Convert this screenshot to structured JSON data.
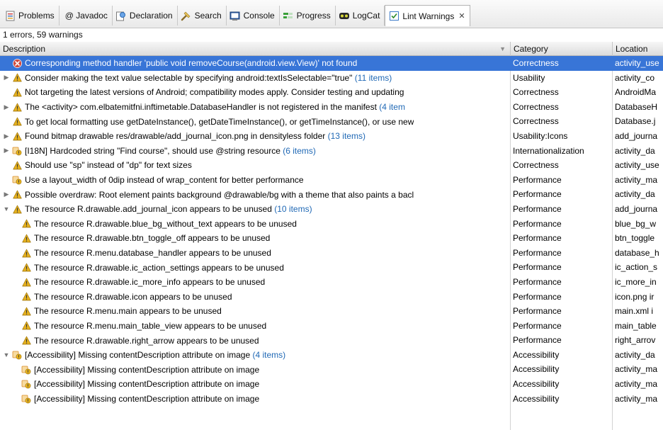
{
  "tabs": [
    {
      "label": "Problems",
      "icon": "problems-icon",
      "active": false
    },
    {
      "label": "@ Javadoc",
      "icon": "none",
      "active": false
    },
    {
      "label": "Declaration",
      "icon": "declaration-icon",
      "active": false
    },
    {
      "label": "Search",
      "icon": "search-icon",
      "active": false
    },
    {
      "label": "Console",
      "icon": "console-icon",
      "active": false
    },
    {
      "label": "Progress",
      "icon": "progress-icon",
      "active": false
    },
    {
      "label": "LogCat",
      "icon": "logcat-icon",
      "active": false
    },
    {
      "label": "Lint Warnings",
      "icon": "lint-checkbox-icon",
      "active": true
    }
  ],
  "close_glyph": "✕",
  "summary": "1 errors, 59 warnings",
  "columns": {
    "description": "Description",
    "category": "Category",
    "location": "Location"
  },
  "colors": {
    "selected": "#3875d7",
    "count_link": "#1f68b5",
    "error": "#d24b3c",
    "warning": "#e7b21e",
    "i18n": "#d98c2a"
  },
  "rows": [
    {
      "indent": 0,
      "twisty": "",
      "severity": "error",
      "description": "Corresponding method handler 'public void removeCourse(android.view.View)' not found",
      "count": "",
      "category": "Correctness",
      "location": "activity_use",
      "selected": true
    },
    {
      "indent": 0,
      "twisty": "collapsed",
      "severity": "warning",
      "description": "Consider making the text value selectable by specifying android:textIsSelectable=\"true\"",
      "count": "(11 items)",
      "category": "Usability",
      "location": "activity_co",
      "selected": false
    },
    {
      "indent": 0,
      "twisty": "",
      "severity": "warning",
      "description": "Not targeting the latest versions of Android; compatibility modes apply. Consider testing and updating",
      "count": "",
      "category": "Correctness",
      "location": "AndroidMa",
      "selected": false
    },
    {
      "indent": 0,
      "twisty": "collapsed",
      "severity": "warning",
      "description": "The <activity> com.elbatemitfni.inftimetable.DatabaseHandler is not registered in the manifest",
      "count": "(4 item",
      "category": "Correctness",
      "location": "DatabaseH",
      "selected": false
    },
    {
      "indent": 0,
      "twisty": "",
      "severity": "warning",
      "description": "To get local formatting use getDateInstance(), getDateTimeInstance(), or getTimeInstance(), or use new",
      "count": "",
      "category": "Correctness",
      "location": "Database.j",
      "selected": false
    },
    {
      "indent": 0,
      "twisty": "collapsed",
      "severity": "warning",
      "description": "Found bitmap drawable res/drawable/add_journal_icon.png in densityless folder",
      "count": "(13 items)",
      "category": "Usability:Icons",
      "location": "add_journa",
      "selected": false
    },
    {
      "indent": 0,
      "twisty": "collapsed",
      "severity": "i18n",
      "description": "[I18N] Hardcoded string \"Find course\", should use @string resource",
      "count": "(6 items)",
      "category": "Internationalization",
      "location": "activity_da",
      "selected": false
    },
    {
      "indent": 0,
      "twisty": "",
      "severity": "warning",
      "description": "Should use \"sp\" instead of \"dp\" for text sizes",
      "count": "",
      "category": "Correctness",
      "location": "activity_use",
      "selected": false
    },
    {
      "indent": 0,
      "twisty": "",
      "severity": "i18n",
      "description": "Use a layout_width of 0dip instead of wrap_content for better performance",
      "count": "",
      "category": "Performance",
      "location": "activity_ma",
      "selected": false
    },
    {
      "indent": 0,
      "twisty": "collapsed",
      "severity": "warning",
      "description": "Possible overdraw: Root element paints background @drawable/bg with a theme that also paints a bacl",
      "count": "",
      "category": "Performance",
      "location": "activity_da",
      "selected": false
    },
    {
      "indent": 0,
      "twisty": "expanded",
      "severity": "warning",
      "description": "The resource R.drawable.add_journal_icon appears to be unused",
      "count": "(10 items)",
      "category": "Performance",
      "location": "add_journa",
      "selected": false
    },
    {
      "indent": 1,
      "twisty": "",
      "severity": "warning",
      "description": "The resource R.drawable.blue_bg_without_text appears to be unused",
      "count": "",
      "category": "Performance",
      "location": "blue_bg_w",
      "selected": false
    },
    {
      "indent": 1,
      "twisty": "",
      "severity": "warning",
      "description": "The resource R.drawable.btn_toggle_off appears to be unused",
      "count": "",
      "category": "Performance",
      "location": "btn_toggle",
      "selected": false
    },
    {
      "indent": 1,
      "twisty": "",
      "severity": "warning",
      "description": "The resource R.menu.database_handler appears to be unused",
      "count": "",
      "category": "Performance",
      "location": "database_h",
      "selected": false
    },
    {
      "indent": 1,
      "twisty": "",
      "severity": "warning",
      "description": "The resource R.drawable.ic_action_settings appears to be unused",
      "count": "",
      "category": "Performance",
      "location": "ic_action_s",
      "selected": false
    },
    {
      "indent": 1,
      "twisty": "",
      "severity": "warning",
      "description": "The resource R.drawable.ic_more_info appears to be unused",
      "count": "",
      "category": "Performance",
      "location": "ic_more_in",
      "selected": false
    },
    {
      "indent": 1,
      "twisty": "",
      "severity": "warning",
      "description": "The resource R.drawable.icon appears to be unused",
      "count": "",
      "category": "Performance",
      "location": "icon.png ir",
      "selected": false
    },
    {
      "indent": 1,
      "twisty": "",
      "severity": "warning",
      "description": "The resource R.menu.main appears to be unused",
      "count": "",
      "category": "Performance",
      "location": "main.xml i",
      "selected": false
    },
    {
      "indent": 1,
      "twisty": "",
      "severity": "warning",
      "description": "The resource R.menu.main_table_view appears to be unused",
      "count": "",
      "category": "Performance",
      "location": "main_table",
      "selected": false
    },
    {
      "indent": 1,
      "twisty": "",
      "severity": "warning",
      "description": "The resource R.drawable.right_arrow appears to be unused",
      "count": "",
      "category": "Performance",
      "location": "right_arrov",
      "selected": false
    },
    {
      "indent": 0,
      "twisty": "expanded",
      "severity": "i18n",
      "description": "[Accessibility] Missing contentDescription attribute on image",
      "count": "(4 items)",
      "category": "Accessibility",
      "location": "activity_da",
      "selected": false
    },
    {
      "indent": 1,
      "twisty": "",
      "severity": "i18n",
      "description": "[Accessibility] Missing contentDescription attribute on image",
      "count": "",
      "category": "Accessibility",
      "location": "activity_ma",
      "selected": false
    },
    {
      "indent": 1,
      "twisty": "",
      "severity": "i18n",
      "description": "[Accessibility] Missing contentDescription attribute on image",
      "count": "",
      "category": "Accessibility",
      "location": "activity_ma",
      "selected": false
    },
    {
      "indent": 1,
      "twisty": "",
      "severity": "i18n",
      "description": "[Accessibility] Missing contentDescription attribute on image",
      "count": "",
      "category": "Accessibility",
      "location": "activity_ma",
      "selected": false
    }
  ]
}
